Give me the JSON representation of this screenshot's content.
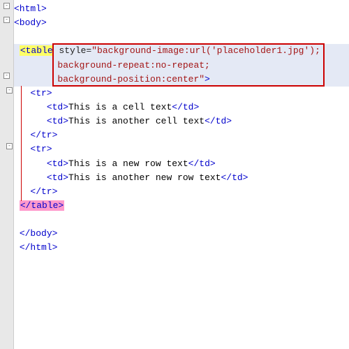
{
  "code": {
    "l1": "<html>",
    "l2": "<body>",
    "l3_open": "<table",
    "l3_attr_key": " style=",
    "l3_attr_val": "\"background-image:url('placeholder1.jpg');",
    "l4_val": "        background-repeat:no-repeat;",
    "l5_val": "        background-position:center\"",
    "l5_close": ">",
    "l6": "<tr>",
    "l7_a": "<td>",
    "l7_t": "This is a cell text",
    "l7_b": "</td>",
    "l8_a": "<td>",
    "l8_t": "This is another cell text",
    "l8_b": "</td>",
    "l9": "</tr>",
    "l10": "<tr>",
    "l11_a": "<td>",
    "l11_t": "This is a new row text",
    "l11_b": "</td>",
    "l12_a": "<td>",
    "l12_t": "This is another new row text",
    "l12_b": "</td>",
    "l13": "</tr>",
    "l14": "</table>",
    "l15": "</body>",
    "l16": "</html>"
  },
  "fold": {
    "minus": "-"
  }
}
